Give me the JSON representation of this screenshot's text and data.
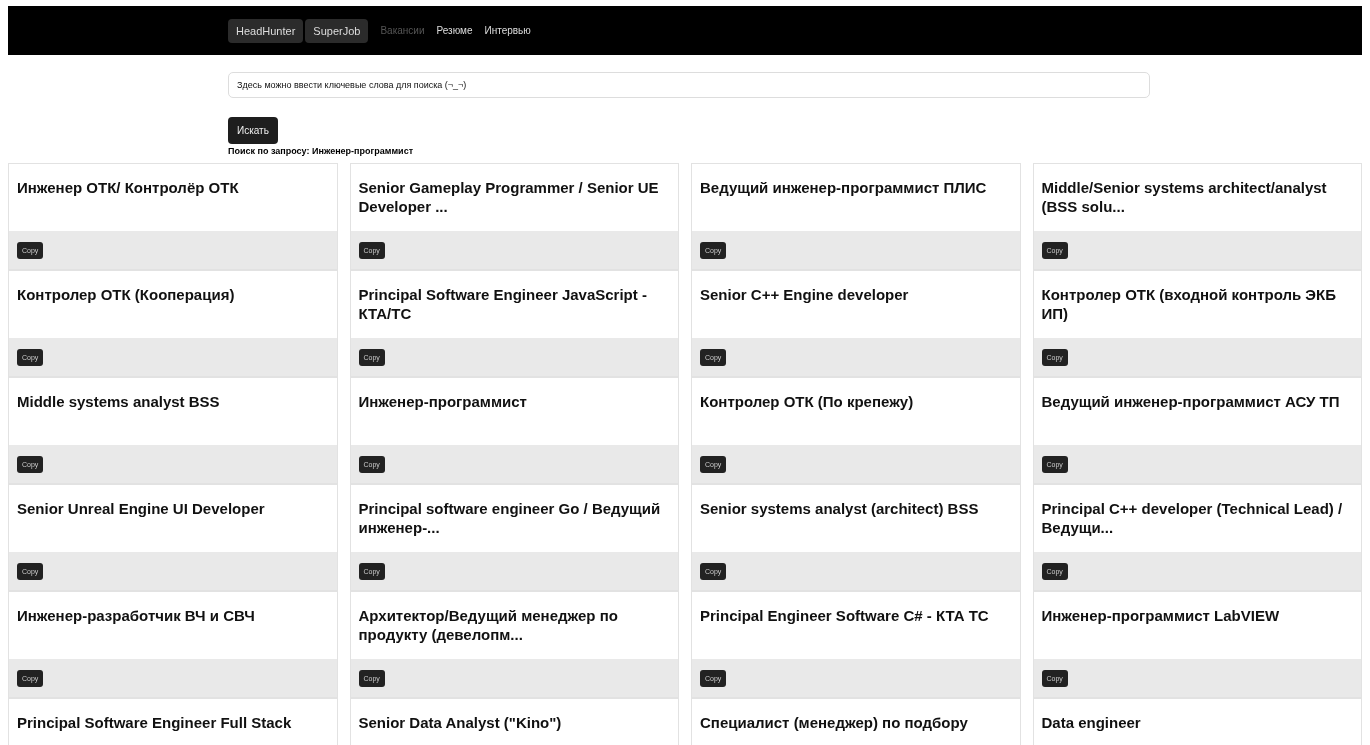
{
  "nav": {
    "sources": [
      {
        "label": "HeadHunter",
        "selected": true
      },
      {
        "label": "SuperJob",
        "selected": true
      }
    ],
    "links": [
      {
        "label": "Вакансии",
        "selected": true
      },
      {
        "label": "Резюме",
        "selected": false
      },
      {
        "label": "Интервью",
        "selected": false
      }
    ]
  },
  "search": {
    "placeholder": "Здесь можно ввести ключевые слова для поиска (¬_¬)",
    "button": "Искать"
  },
  "query_info": "Поиск по запросу: Инженер-программист",
  "vacancies": [
    {
      "title": "Инженер ОТК/ Контролёр ОТК",
      "button": "Copy"
    },
    {
      "title": "Senior Gameplay Programmer / Senior UE Developer ...",
      "button": "Copy"
    },
    {
      "title": "Ведущий инженер-программист ПЛИС",
      "button": "Copy"
    },
    {
      "title": "Middle/Senior systems architect/analyst (BSS solu...",
      "button": "Copy"
    },
    {
      "title": "Контролер ОТК (Кооперация)",
      "button": "Copy"
    },
    {
      "title": "Principal Software Engineer JavaScript - КТА/ТС",
      "button": "Copy"
    },
    {
      "title": "Senior C++ Engine developer",
      "button": "Copy"
    },
    {
      "title": "Контролер ОТК (входной контроль ЭКБ ИП)",
      "button": "Copy"
    },
    {
      "title": "Middle systems analyst BSS",
      "button": "Copy"
    },
    {
      "title": "Инженер-программист",
      "button": "Copy"
    },
    {
      "title": "Контролер ОТК (По крепежу)",
      "button": "Copy"
    },
    {
      "title": "Ведущий инженер-программист АСУ ТП",
      "button": "Copy"
    },
    {
      "title": "Senior Unreal Engine UI Developer",
      "button": "Copy"
    },
    {
      "title": "Principal software engineer Go / Ведущий инженер-...",
      "button": "Copy"
    },
    {
      "title": "Senior systems analyst (architect) BSS",
      "button": "Copy"
    },
    {
      "title": "Principal C++ developer (Technical Lead) / Ведущи...",
      "button": "Copy"
    },
    {
      "title": "Инженер-разработчик ВЧ и СВЧ",
      "button": "Copy"
    },
    {
      "title": "Архитектор/Ведущий менеджер по продукту (девелопм...",
      "button": "Copy"
    },
    {
      "title": "Principal Engineer Software C# - КТА ТС",
      "button": "Copy"
    },
    {
      "title": "Инженер-программист LabVIEW",
      "button": "Copy"
    },
    {
      "title": "Principal Software Engineer Full Stack"
    },
    {
      "title": "Senior Data Analyst (\"Kino\")"
    },
    {
      "title": "Специалист (менеджер) по подбору"
    },
    {
      "title": "Data engineer"
    }
  ]
}
